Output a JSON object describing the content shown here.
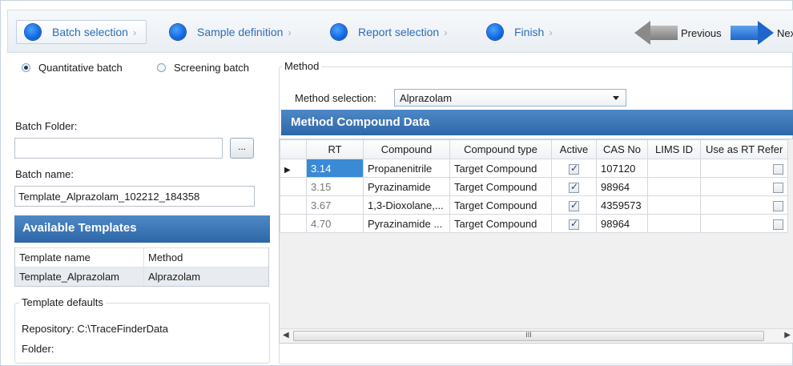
{
  "wizard": {
    "steps": [
      {
        "label": "Batch selection"
      },
      {
        "label": "Sample definition"
      },
      {
        "label": "Report selection"
      },
      {
        "label": "Finish"
      }
    ],
    "chevron": "›",
    "previous_label": "Previous",
    "next_label": "Next"
  },
  "batch": {
    "quantitative_label": "Quantitative batch",
    "screening_label": "Screening batch",
    "selected_type": "Quantitative batch",
    "folder_label": "Batch Folder:",
    "folder_value": "",
    "browse_label": "...",
    "name_label": "Batch name:",
    "name_value": "Template_Alprazolam_102212_184358"
  },
  "templates": {
    "title": "Available Templates",
    "columns": [
      "Template name",
      "Method"
    ],
    "rows": [
      {
        "name": "Template_Alprazolam",
        "method": "Alprazolam"
      }
    ]
  },
  "defaults": {
    "legend": "Template defaults",
    "repository": "Repository: C:\\TraceFinderData",
    "folder": "Folder:"
  },
  "method": {
    "legend": "Method",
    "selection_label": "Method selection:",
    "selection_value": "Alprazolam",
    "grid_title": "Method Compound Data",
    "columns": [
      "RT",
      "Compound",
      "Compound type",
      "Active",
      "CAS No",
      "LIMS ID",
      "Use as RT Refer"
    ],
    "rows": [
      {
        "rt": "3.14",
        "compound": "Propanenitrile",
        "type": "Target Compound",
        "active": true,
        "cas": "107120",
        "lims": "",
        "rtref": false,
        "current": true
      },
      {
        "rt": "3.15",
        "compound": "Pyrazinamide",
        "type": "Target Compound",
        "active": true,
        "cas": "98964",
        "lims": "",
        "rtref": false,
        "current": false
      },
      {
        "rt": "3.67",
        "compound": "1,3-Dioxolane,...",
        "type": "Target Compound",
        "active": true,
        "cas": "4359573",
        "lims": "",
        "rtref": false,
        "current": false
      },
      {
        "rt": "4.70",
        "compound": "Pyrazinamide ...",
        "type": "Target Compound",
        "active": true,
        "cas": "98964",
        "lims": "",
        "rtref": false,
        "current": false
      }
    ],
    "scroll_left": "◀",
    "scroll_right": "▶",
    "scroll_grip": "III"
  },
  "colors": {
    "header_blue": "#2d67a8",
    "step_blue": "#2f6db5",
    "selected_cell": "#3a8ad6"
  }
}
